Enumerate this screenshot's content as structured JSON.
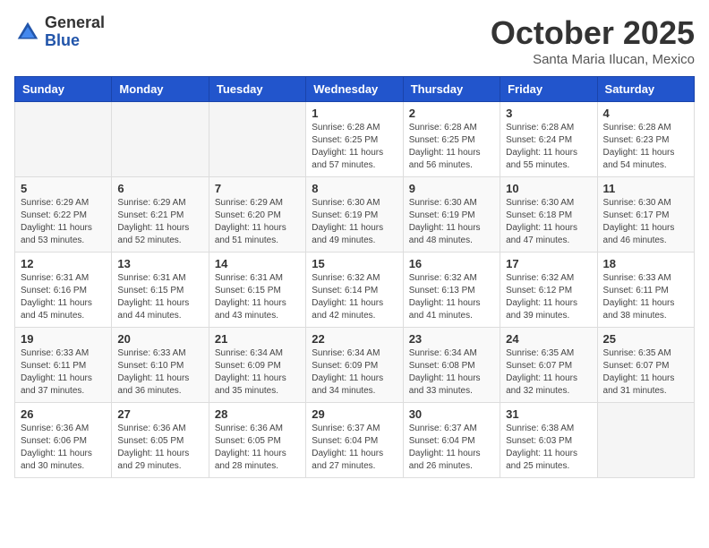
{
  "header": {
    "logo_general": "General",
    "logo_blue": "Blue",
    "title": "October 2025",
    "location": "Santa Maria Ilucan, Mexico"
  },
  "days_of_week": [
    "Sunday",
    "Monday",
    "Tuesday",
    "Wednesday",
    "Thursday",
    "Friday",
    "Saturday"
  ],
  "weeks": [
    [
      {
        "day": "",
        "info": ""
      },
      {
        "day": "",
        "info": ""
      },
      {
        "day": "",
        "info": ""
      },
      {
        "day": "1",
        "info": "Sunrise: 6:28 AM\nSunset: 6:25 PM\nDaylight: 11 hours\nand 57 minutes."
      },
      {
        "day": "2",
        "info": "Sunrise: 6:28 AM\nSunset: 6:25 PM\nDaylight: 11 hours\nand 56 minutes."
      },
      {
        "day": "3",
        "info": "Sunrise: 6:28 AM\nSunset: 6:24 PM\nDaylight: 11 hours\nand 55 minutes."
      },
      {
        "day": "4",
        "info": "Sunrise: 6:28 AM\nSunset: 6:23 PM\nDaylight: 11 hours\nand 54 minutes."
      }
    ],
    [
      {
        "day": "5",
        "info": "Sunrise: 6:29 AM\nSunset: 6:22 PM\nDaylight: 11 hours\nand 53 minutes."
      },
      {
        "day": "6",
        "info": "Sunrise: 6:29 AM\nSunset: 6:21 PM\nDaylight: 11 hours\nand 52 minutes."
      },
      {
        "day": "7",
        "info": "Sunrise: 6:29 AM\nSunset: 6:20 PM\nDaylight: 11 hours\nand 51 minutes."
      },
      {
        "day": "8",
        "info": "Sunrise: 6:30 AM\nSunset: 6:19 PM\nDaylight: 11 hours\nand 49 minutes."
      },
      {
        "day": "9",
        "info": "Sunrise: 6:30 AM\nSunset: 6:19 PM\nDaylight: 11 hours\nand 48 minutes."
      },
      {
        "day": "10",
        "info": "Sunrise: 6:30 AM\nSunset: 6:18 PM\nDaylight: 11 hours\nand 47 minutes."
      },
      {
        "day": "11",
        "info": "Sunrise: 6:30 AM\nSunset: 6:17 PM\nDaylight: 11 hours\nand 46 minutes."
      }
    ],
    [
      {
        "day": "12",
        "info": "Sunrise: 6:31 AM\nSunset: 6:16 PM\nDaylight: 11 hours\nand 45 minutes."
      },
      {
        "day": "13",
        "info": "Sunrise: 6:31 AM\nSunset: 6:15 PM\nDaylight: 11 hours\nand 44 minutes."
      },
      {
        "day": "14",
        "info": "Sunrise: 6:31 AM\nSunset: 6:15 PM\nDaylight: 11 hours\nand 43 minutes."
      },
      {
        "day": "15",
        "info": "Sunrise: 6:32 AM\nSunset: 6:14 PM\nDaylight: 11 hours\nand 42 minutes."
      },
      {
        "day": "16",
        "info": "Sunrise: 6:32 AM\nSunset: 6:13 PM\nDaylight: 11 hours\nand 41 minutes."
      },
      {
        "day": "17",
        "info": "Sunrise: 6:32 AM\nSunset: 6:12 PM\nDaylight: 11 hours\nand 39 minutes."
      },
      {
        "day": "18",
        "info": "Sunrise: 6:33 AM\nSunset: 6:11 PM\nDaylight: 11 hours\nand 38 minutes."
      }
    ],
    [
      {
        "day": "19",
        "info": "Sunrise: 6:33 AM\nSunset: 6:11 PM\nDaylight: 11 hours\nand 37 minutes."
      },
      {
        "day": "20",
        "info": "Sunrise: 6:33 AM\nSunset: 6:10 PM\nDaylight: 11 hours\nand 36 minutes."
      },
      {
        "day": "21",
        "info": "Sunrise: 6:34 AM\nSunset: 6:09 PM\nDaylight: 11 hours\nand 35 minutes."
      },
      {
        "day": "22",
        "info": "Sunrise: 6:34 AM\nSunset: 6:09 PM\nDaylight: 11 hours\nand 34 minutes."
      },
      {
        "day": "23",
        "info": "Sunrise: 6:34 AM\nSunset: 6:08 PM\nDaylight: 11 hours\nand 33 minutes."
      },
      {
        "day": "24",
        "info": "Sunrise: 6:35 AM\nSunset: 6:07 PM\nDaylight: 11 hours\nand 32 minutes."
      },
      {
        "day": "25",
        "info": "Sunrise: 6:35 AM\nSunset: 6:07 PM\nDaylight: 11 hours\nand 31 minutes."
      }
    ],
    [
      {
        "day": "26",
        "info": "Sunrise: 6:36 AM\nSunset: 6:06 PM\nDaylight: 11 hours\nand 30 minutes."
      },
      {
        "day": "27",
        "info": "Sunrise: 6:36 AM\nSunset: 6:05 PM\nDaylight: 11 hours\nand 29 minutes."
      },
      {
        "day": "28",
        "info": "Sunrise: 6:36 AM\nSunset: 6:05 PM\nDaylight: 11 hours\nand 28 minutes."
      },
      {
        "day": "29",
        "info": "Sunrise: 6:37 AM\nSunset: 6:04 PM\nDaylight: 11 hours\nand 27 minutes."
      },
      {
        "day": "30",
        "info": "Sunrise: 6:37 AM\nSunset: 6:04 PM\nDaylight: 11 hours\nand 26 minutes."
      },
      {
        "day": "31",
        "info": "Sunrise: 6:38 AM\nSunset: 6:03 PM\nDaylight: 11 hours\nand 25 minutes."
      },
      {
        "day": "",
        "info": ""
      }
    ]
  ]
}
